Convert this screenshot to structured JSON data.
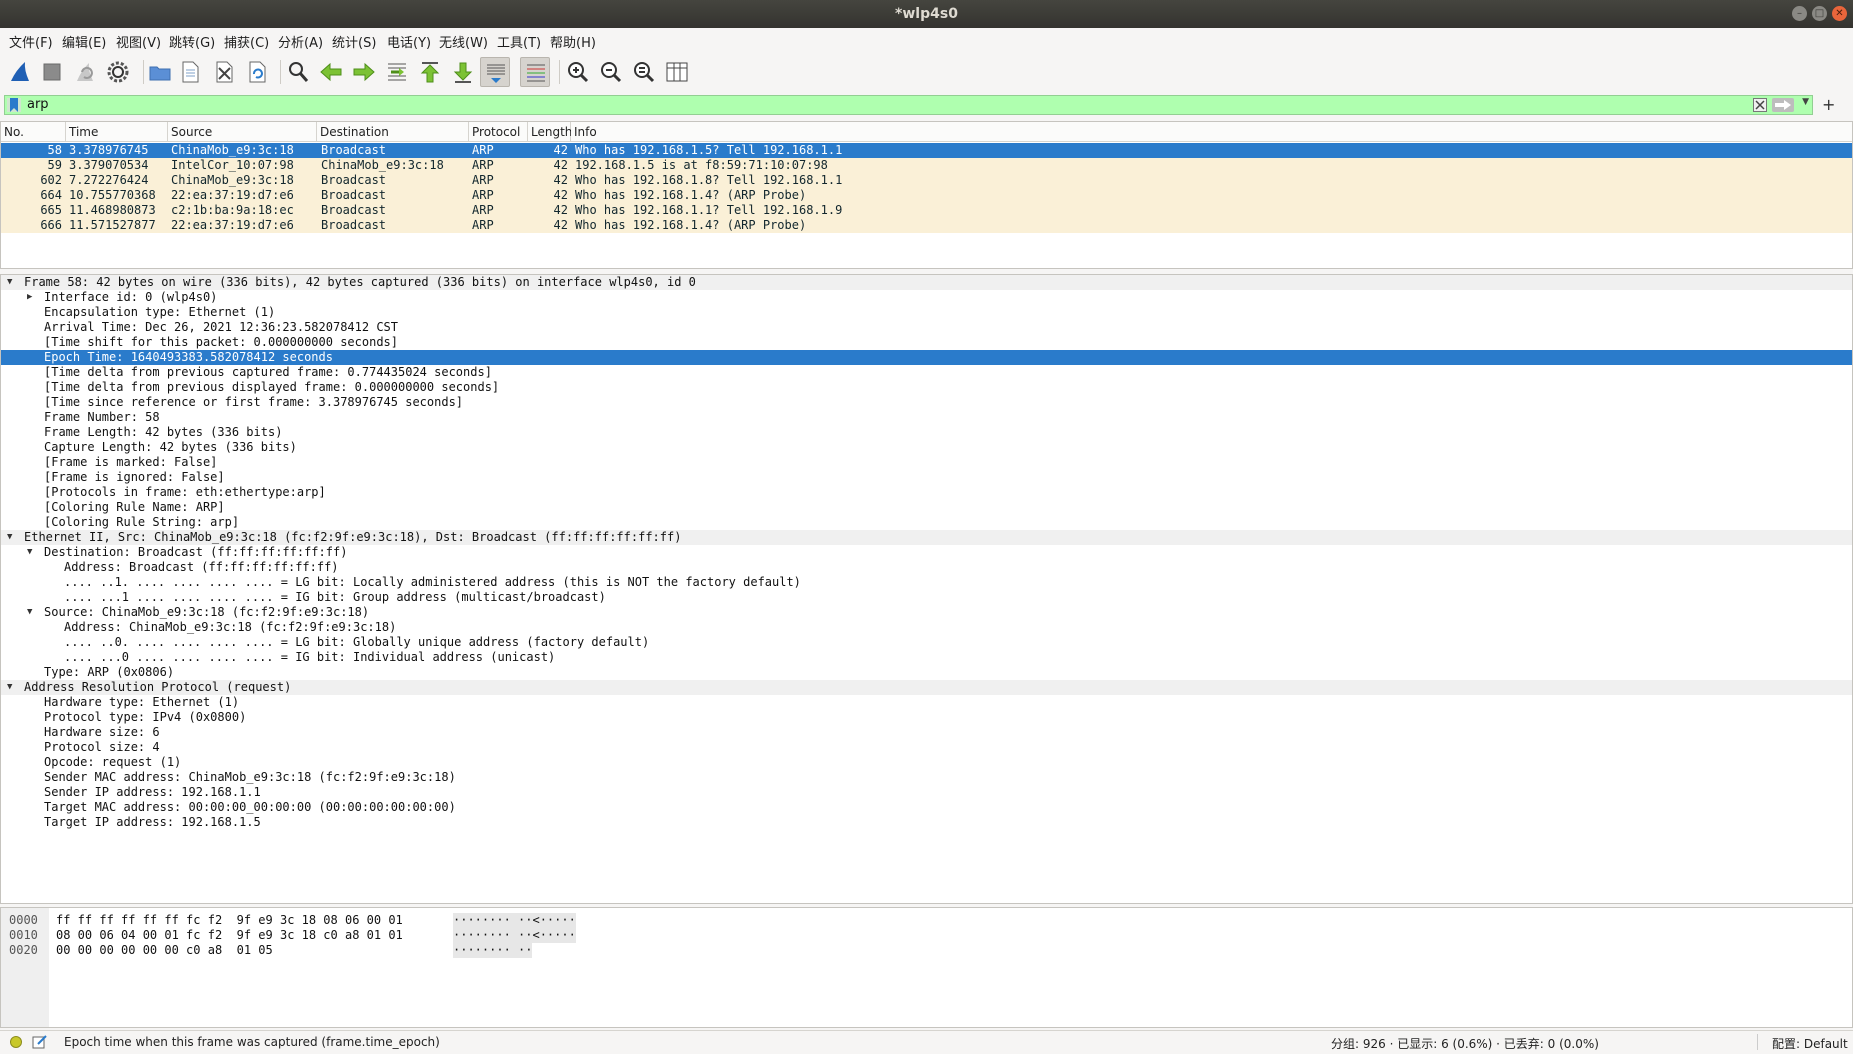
{
  "window": {
    "title": "*wlp4s0"
  },
  "menu": [
    "文件(F)",
    "编辑(E)",
    "视图(V)",
    "跳转(G)",
    "捕获(C)",
    "分析(A)",
    "统计(S)",
    "电话(Y)",
    "无线(W)",
    "工具(T)",
    "帮助(H)"
  ],
  "toolbar_icons": [
    "shark-fin-start-icon",
    "stop-square-icon",
    "restart-fin-icon",
    "gear-options-icon",
    "folder-open-icon",
    "file-save-icon",
    "close-file-icon",
    "reload-icon",
    "search-icon",
    "arrow-back-icon",
    "arrow-forward-icon",
    "goto-packet-icon",
    "first-packet-icon",
    "last-packet-icon",
    "autoscroll-icon",
    "colorize-icon",
    "zoom-in-icon",
    "zoom-out-icon",
    "zoom-normal-icon",
    "resize-columns-icon"
  ],
  "filter": {
    "value": "arp"
  },
  "packet_list": {
    "columns": [
      "No.",
      "Time",
      "Source",
      "Destination",
      "Protocol",
      "Length",
      "Info"
    ],
    "rows": [
      {
        "no": "58",
        "time": "3.378976745",
        "source": "ChinaMob_e9:3c:18",
        "destination": "Broadcast",
        "protocol": "ARP",
        "length": "42",
        "info": "Who has 192.168.1.5? Tell 192.168.1.1"
      },
      {
        "no": "59",
        "time": "3.379070534",
        "source": "IntelCor_10:07:98",
        "destination": "ChinaMob_e9:3c:18",
        "protocol": "ARP",
        "length": "42",
        "info": "192.168.1.5 is at f8:59:71:10:07:98"
      },
      {
        "no": "602",
        "time": "7.272276424",
        "source": "ChinaMob_e9:3c:18",
        "destination": "Broadcast",
        "protocol": "ARP",
        "length": "42",
        "info": "Who has 192.168.1.8? Tell 192.168.1.1"
      },
      {
        "no": "664",
        "time": "10.755770368",
        "source": "22:ea:37:19:d7:e6",
        "destination": "Broadcast",
        "protocol": "ARP",
        "length": "42",
        "info": "Who has 192.168.1.4? (ARP Probe)"
      },
      {
        "no": "665",
        "time": "11.468980873",
        "source": "c2:1b:ba:9a:18:ec",
        "destination": "Broadcast",
        "protocol": "ARP",
        "length": "42",
        "info": "Who has 192.168.1.1? Tell 192.168.1.9"
      },
      {
        "no": "666",
        "time": "11.571527877",
        "source": "22:ea:37:19:d7:e6",
        "destination": "Broadcast",
        "protocol": "ARP",
        "length": "42",
        "info": "Who has 192.168.1.4? (ARP Probe)"
      }
    ]
  },
  "details": [
    {
      "level": 0,
      "tw": "open",
      "hdr": true,
      "text": "Frame 58: 42 bytes on wire (336 bits), 42 bytes captured (336 bits) on interface wlp4s0, id 0"
    },
    {
      "level": 1,
      "tw": "closed",
      "text": "Interface id: 0 (wlp4s0)"
    },
    {
      "level": 1,
      "text": "Encapsulation type: Ethernet (1)"
    },
    {
      "level": 1,
      "text": "Arrival Time: Dec 26, 2021 12:36:23.582078412 CST"
    },
    {
      "level": 1,
      "text": "[Time shift for this packet: 0.000000000 seconds]"
    },
    {
      "level": 1,
      "sel": true,
      "text": "Epoch Time: 1640493383.582078412 seconds"
    },
    {
      "level": 1,
      "text": "[Time delta from previous captured frame: 0.774435024 seconds]"
    },
    {
      "level": 1,
      "text": "[Time delta from previous displayed frame: 0.000000000 seconds]"
    },
    {
      "level": 1,
      "text": "[Time since reference or first frame: 3.378976745 seconds]"
    },
    {
      "level": 1,
      "text": "Frame Number: 58"
    },
    {
      "level": 1,
      "text": "Frame Length: 42 bytes (336 bits)"
    },
    {
      "level": 1,
      "text": "Capture Length: 42 bytes (336 bits)"
    },
    {
      "level": 1,
      "text": "[Frame is marked: False]"
    },
    {
      "level": 1,
      "text": "[Frame is ignored: False]"
    },
    {
      "level": 1,
      "text": "[Protocols in frame: eth:ethertype:arp]"
    },
    {
      "level": 1,
      "text": "[Coloring Rule Name: ARP]"
    },
    {
      "level": 1,
      "text": "[Coloring Rule String: arp]"
    },
    {
      "level": 0,
      "tw": "open",
      "hdr": true,
      "text": "Ethernet II, Src: ChinaMob_e9:3c:18 (fc:f2:9f:e9:3c:18), Dst: Broadcast (ff:ff:ff:ff:ff:ff)"
    },
    {
      "level": 1,
      "tw": "open",
      "text": "Destination: Broadcast (ff:ff:ff:ff:ff:ff)"
    },
    {
      "level": 2,
      "text": "Address: Broadcast (ff:ff:ff:ff:ff:ff)"
    },
    {
      "level": 2,
      "text": ".... ..1. .... .... .... .... = LG bit: Locally administered address (this is NOT the factory default)"
    },
    {
      "level": 2,
      "text": ".... ...1 .... .... .... .... = IG bit: Group address (multicast/broadcast)"
    },
    {
      "level": 1,
      "tw": "open",
      "text": "Source: ChinaMob_e9:3c:18 (fc:f2:9f:e9:3c:18)"
    },
    {
      "level": 2,
      "text": "Address: ChinaMob_e9:3c:18 (fc:f2:9f:e9:3c:18)"
    },
    {
      "level": 2,
      "text": ".... ..0. .... .... .... .... = LG bit: Globally unique address (factory default)"
    },
    {
      "level": 2,
      "text": ".... ...0 .... .... .... .... = IG bit: Individual address (unicast)"
    },
    {
      "level": 1,
      "text": "Type: ARP (0x0806)"
    },
    {
      "level": 0,
      "tw": "open",
      "hdr": true,
      "text": "Address Resolution Protocol (request)"
    },
    {
      "level": 1,
      "text": "Hardware type: Ethernet (1)"
    },
    {
      "level": 1,
      "text": "Protocol type: IPv4 (0x0800)"
    },
    {
      "level": 1,
      "text": "Hardware size: 6"
    },
    {
      "level": 1,
      "text": "Protocol size: 4"
    },
    {
      "level": 1,
      "text": "Opcode: request (1)"
    },
    {
      "level": 1,
      "text": "Sender MAC address: ChinaMob_e9:3c:18 (fc:f2:9f:e9:3c:18)"
    },
    {
      "level": 1,
      "text": "Sender IP address: 192.168.1.1"
    },
    {
      "level": 1,
      "text": "Target MAC address: 00:00:00_00:00:00 (00:00:00:00:00:00)"
    },
    {
      "level": 1,
      "text": "Target IP address: 192.168.1.5"
    }
  ],
  "bytes": [
    {
      "offset": "0000",
      "hex": "ff ff ff ff ff ff fc f2  9f e9 3c 18 08 06 00 01",
      "ascii": "········ ··<·····"
    },
    {
      "offset": "0010",
      "hex": "08 00 06 04 00 01 fc f2  9f e9 3c 18 c0 a8 01 01",
      "ascii": "········ ··<·····"
    },
    {
      "offset": "0020",
      "hex": "00 00 00 00 00 00 c0 a8  01 05",
      "ascii": "········ ··"
    }
  ],
  "status": {
    "message": "Epoch time when this frame was captured (frame.time_epoch)",
    "stats": "分组: 926 · 已显示: 6 (0.6%) · 已丢弃: 0 (0.0%)",
    "profile": "配置: Default"
  },
  "colors": {
    "selection": "#2a7bcb",
    "arp_row": "#faf0d7",
    "filter_bg": "#afffaf"
  }
}
